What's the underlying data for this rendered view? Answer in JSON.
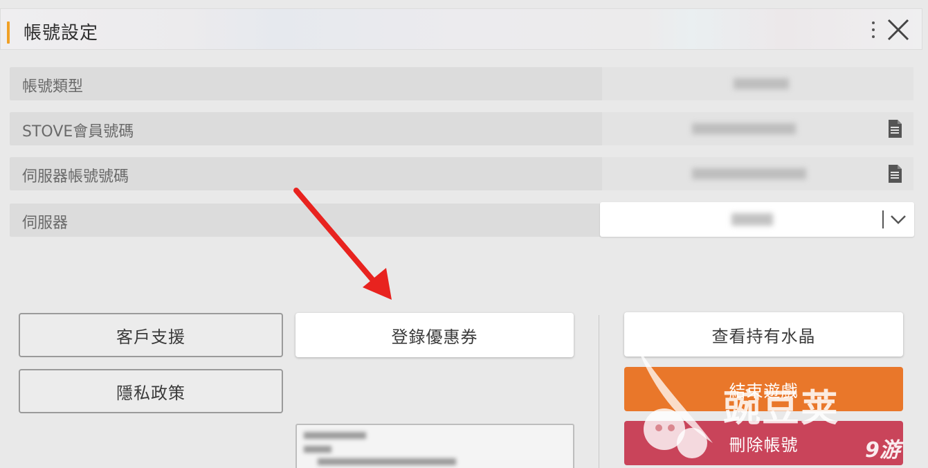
{
  "header": {
    "title": "帳號設定"
  },
  "rows": [
    {
      "label": "帳號類型"
    },
    {
      "label": "STOVE會員號碼"
    },
    {
      "label": "伺服器帳號號碼"
    },
    {
      "label": "伺服器"
    }
  ],
  "buttons": {
    "customer_support": "客戶支援",
    "privacy_policy": "隱私政策",
    "register_coupon": "登錄優惠券",
    "view_crystals": "查看持有水晶",
    "end_game": "結束遊戲",
    "delete_account": "刪除帳號"
  },
  "watermark": {
    "text": "豌豆荚",
    "brand": "9游"
  },
  "colors": {
    "accent": "#f0a025",
    "orange_button": "#e9772a",
    "red_button": "#c9445a",
    "arrow": "#e8231f"
  },
  "icons": [
    "kebab-menu-icon",
    "close-icon",
    "copy-document-icon",
    "chevron-down-icon"
  ]
}
